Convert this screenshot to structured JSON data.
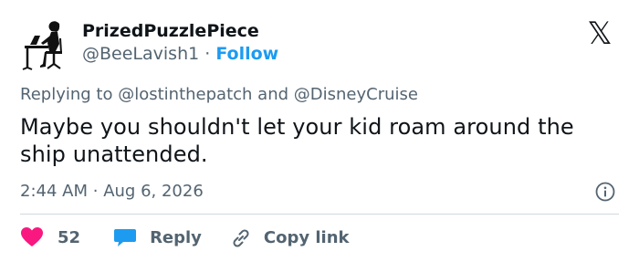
{
  "author": {
    "display_name": "PrizedPuzzlePiece",
    "handle": "@BeeLavish1",
    "separator": "·",
    "follow_label": "Follow",
    "avatar_icon": "woman-at-computer-silhouette-icon"
  },
  "platform_logo": {
    "icon": "x-logo-icon",
    "glyph": "𝕏"
  },
  "reply_context": {
    "prefix": "Replying to",
    "mention1": "@lostinthepatch",
    "conjunction": "and",
    "mention2": "@DisneyCruise"
  },
  "tweet": {
    "text": "Maybe you shouldn't let your kid roam around the ship unattended."
  },
  "meta": {
    "time": "2:44 AM",
    "separator": "·",
    "date": "Aug 6, 2026",
    "info_icon": "info-icon"
  },
  "actions": {
    "likes_count": "52",
    "reply_label": "Reply",
    "copy_link_label": "Copy link"
  },
  "colors": {
    "like": "#f91880",
    "link": "#1d9bf0",
    "muted": "#536471",
    "text": "#0f1419",
    "divider": "#cfd9de"
  }
}
